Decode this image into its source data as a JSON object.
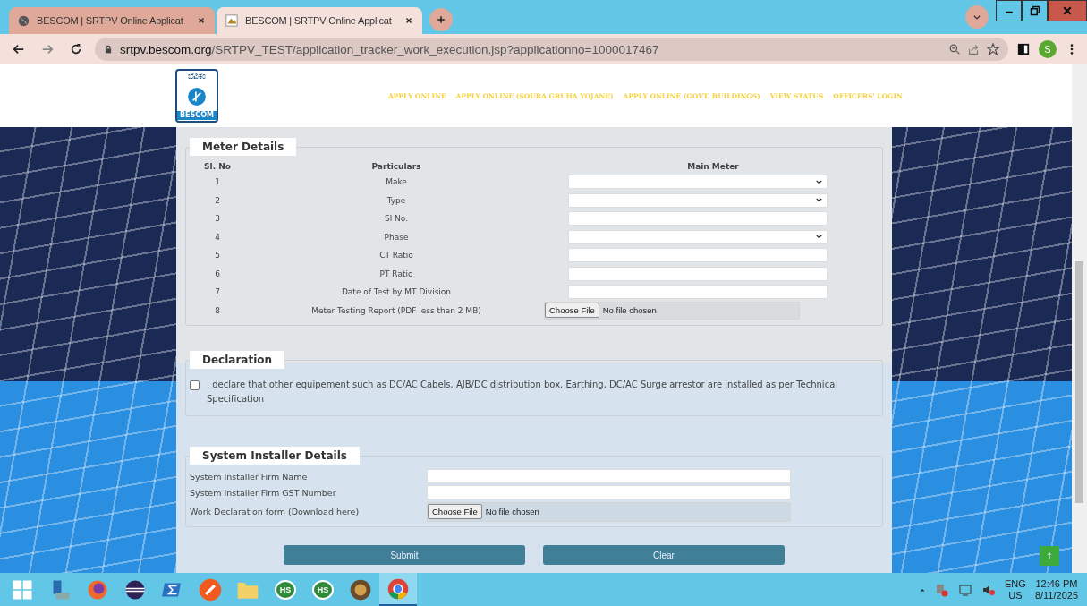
{
  "browser": {
    "tabs": [
      {
        "title": "BESCOM | SRTPV Online Applicat",
        "selected": false,
        "kind": "globe"
      },
      {
        "title": "BESCOM | SRTPV Online Applicat",
        "selected": true,
        "kind": "image"
      }
    ],
    "address": {
      "host": "srtpv.bescom.org",
      "path": "/SRTPV_TEST/application_tracker_work_execution.jsp?applicationno=1000017467"
    },
    "profile": "S"
  },
  "header": {
    "logo_top": "ಬೆವಿಕಂ",
    "logo_bottom": "BESCOM",
    "nav": [
      "APPLY ONLINE",
      "APPLY ONLINE (SOURA GRUHA YOJANE)",
      "APPLY ONLINE (GOVT. BUILDINGS)",
      "VIEW STATUS",
      "OFFICERS' LOGIN"
    ]
  },
  "meter_details": {
    "legend": "Meter Details",
    "columns": [
      "Sl. No",
      "Particulars",
      "Main Meter"
    ],
    "rows": [
      {
        "sl": "1",
        "particular": "Make",
        "kind": "select"
      },
      {
        "sl": "2",
        "particular": "Type",
        "kind": "select"
      },
      {
        "sl": "3",
        "particular": "Sl No.",
        "kind": "text"
      },
      {
        "sl": "4",
        "particular": "Phase",
        "kind": "select"
      },
      {
        "sl": "5",
        "particular": "CT Ratio",
        "kind": "text"
      },
      {
        "sl": "6",
        "particular": "PT Ratio",
        "kind": "text"
      },
      {
        "sl": "7",
        "particular": "Date of Test by MT Division",
        "kind": "text"
      },
      {
        "sl": "8",
        "particular": "Meter Testing Report (PDF less than 2 MB)",
        "kind": "file",
        "button": "Choose File",
        "status": "No file chosen"
      }
    ]
  },
  "declaration": {
    "legend": "Declaration",
    "checked": false,
    "text": "I declare that other equipement such as DC/AC Cabels, AJB/DC distribution box, Earthing, DC/AC Surge arrestor are installed as per Technical Specification"
  },
  "installer": {
    "legend": "System Installer Details",
    "rows": [
      {
        "label": "System Installer Firm Name",
        "kind": "text"
      },
      {
        "label": "System Installer Firm GST Number",
        "kind": "text"
      },
      {
        "label": "Work Declaration form (Download here)",
        "kind": "file",
        "button": "Choose File",
        "status": "No file chosen"
      }
    ]
  },
  "buttons": [
    "Submit",
    "Clear"
  ],
  "taskbar": {
    "apps": [
      {
        "kind": "windows",
        "selected": false
      },
      {
        "kind": "files",
        "selected": false
      },
      {
        "kind": "firefox",
        "selected": false
      },
      {
        "kind": "eclipse",
        "selected": false
      },
      {
        "kind": "shell",
        "selected": false
      },
      {
        "kind": "pen",
        "selected": false
      },
      {
        "kind": "folder",
        "selected": false
      },
      {
        "kind": "hs",
        "label": "HS",
        "selected": false
      },
      {
        "kind": "hs",
        "label": "HS",
        "selected": false
      },
      {
        "kind": "gear",
        "selected": false
      },
      {
        "kind": "chrome",
        "selected": true
      }
    ],
    "lang": "ENG",
    "region": "US",
    "time": "12:46 PM",
    "date": "8/11/2025"
  }
}
